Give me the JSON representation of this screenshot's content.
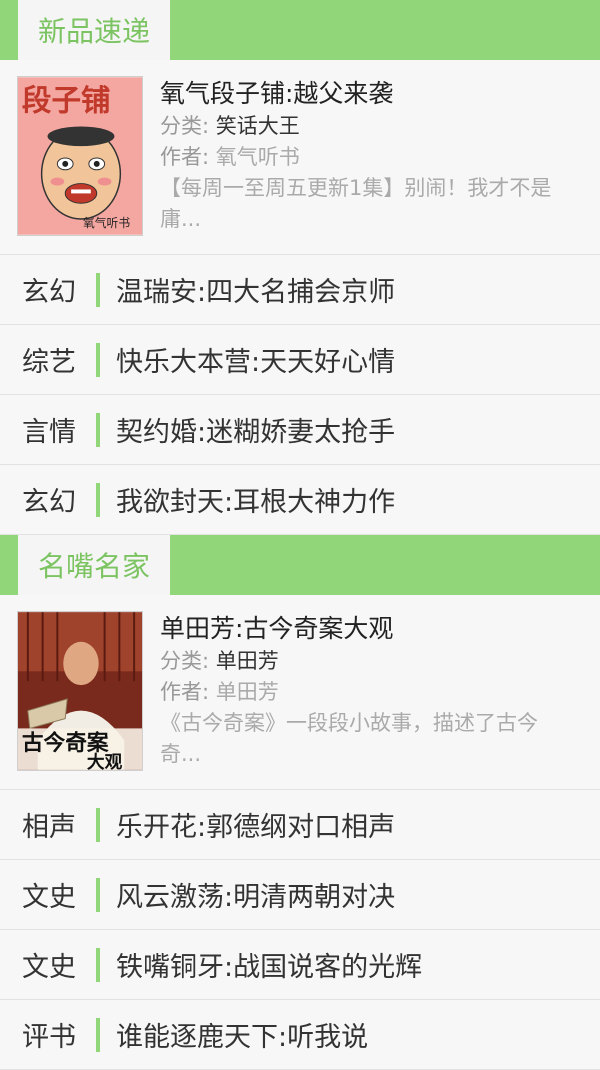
{
  "sections": [
    {
      "title": "新品速递",
      "featured": {
        "title": "氧气段子铺:越父来袭",
        "category_label": "分类:",
        "category_value": "笑话大王",
        "author_label": "作者:",
        "author_value": "氧气听书",
        "description": "【每周一至周五更新1集】别闹！我才不是庸...",
        "cover_text_top": "段子铺",
        "cover_text_bottom": "氧气听书"
      },
      "items": [
        {
          "category": "玄幻",
          "title": "温瑞安:四大名捕会京师"
        },
        {
          "category": "综艺",
          "title": "快乐大本营:天天好心情"
        },
        {
          "category": "言情",
          "title": "契约婚:迷糊娇妻太抢手"
        },
        {
          "category": "玄幻",
          "title": "我欲封天:耳根大神力作"
        }
      ]
    },
    {
      "title": "名嘴名家",
      "featured": {
        "title": "单田芳:古今奇案大观",
        "category_label": "分类:",
        "category_value": "单田芳",
        "author_label": "作者:",
        "author_value": "单田芳",
        "description": "《古今奇案》一段段小故事，描述了古今奇...",
        "cover_text_line1": "古今奇案",
        "cover_text_line2": "大观"
      },
      "items": [
        {
          "category": "相声",
          "title": "乐开花:郭德纲对口相声"
        },
        {
          "category": "文史",
          "title": "风云激荡:明清两朝对决"
        },
        {
          "category": "文史",
          "title": "铁嘴铜牙:战国说客的光辉"
        },
        {
          "category": "评书",
          "title": "谁能逐鹿天下:听我说"
        }
      ]
    }
  ],
  "colors": {
    "accent": "#92d67a",
    "accent_text": "#7cc462"
  }
}
